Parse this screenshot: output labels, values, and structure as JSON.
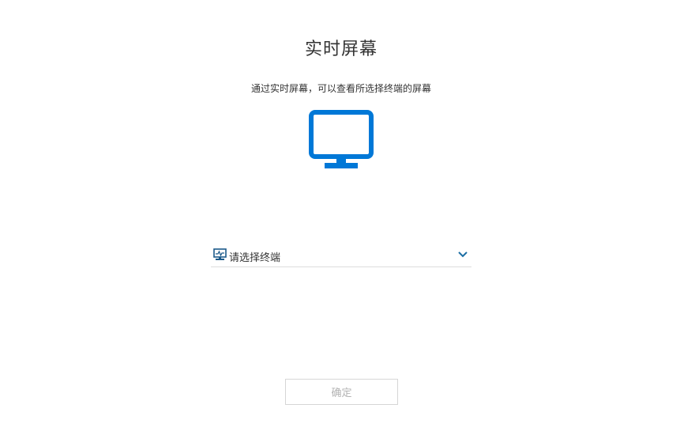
{
  "page": {
    "title": "实时屏幕",
    "subtitle": "通过实时屏幕，可以查看所选择终端的屏幕"
  },
  "terminal_select": {
    "placeholder": "请选择终端",
    "icon": "terminal-icon",
    "dropdown_icon": "chevron-down-icon"
  },
  "confirm_button": {
    "label": "确定",
    "disabled": true
  },
  "colors": {
    "accent": "#0078d7",
    "text": "#333333",
    "border": "#dcdcdc",
    "disabled_text": "#b3b3b3"
  },
  "hero_icon": "monitor-icon"
}
